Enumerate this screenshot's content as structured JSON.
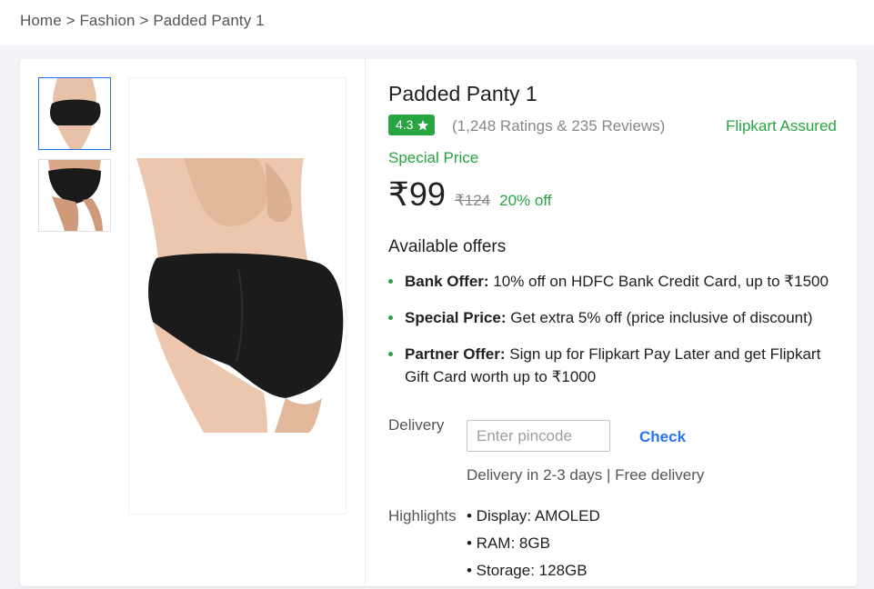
{
  "breadcrumb": {
    "home": "Home",
    "sep1": ">",
    "category": "Fashion",
    "sep2": ">",
    "current": "Padded Panty 1"
  },
  "product": {
    "title": "Padded Panty 1",
    "rating": "4.3",
    "rating_icon": "star-icon",
    "ratings_reviews": "(1,248 Ratings & 235 Reviews)",
    "assured": "Flipkart Assured",
    "special_price_label": "Special Price",
    "price": "₹99",
    "mrp": "₹124",
    "discount": "20% off"
  },
  "offers": {
    "title": "Available offers",
    "items": [
      {
        "label": "Bank Offer:",
        "text": " 10% off on HDFC Bank Credit Card, up to ₹1500"
      },
      {
        "label": "Special Price:",
        "text": " Get extra 5% off (price inclusive of discount)"
      },
      {
        "label": "Partner Offer:",
        "text": " Sign up for Flipkart Pay Later and get Flipkart Gift Card worth up to ₹1000"
      }
    ]
  },
  "delivery": {
    "label": "Delivery",
    "placeholder": "Enter pincode",
    "value": "",
    "check_label": "Check",
    "info": "Delivery in 2-3 days | Free delivery"
  },
  "highlights": {
    "label": "Highlights",
    "items": [
      "• Display: AMOLED",
      "• RAM: 8GB",
      "• Storage: 128GB"
    ]
  },
  "colors": {
    "green": "#26a541",
    "blue": "#2874f0",
    "background": "#f1f3f6"
  }
}
